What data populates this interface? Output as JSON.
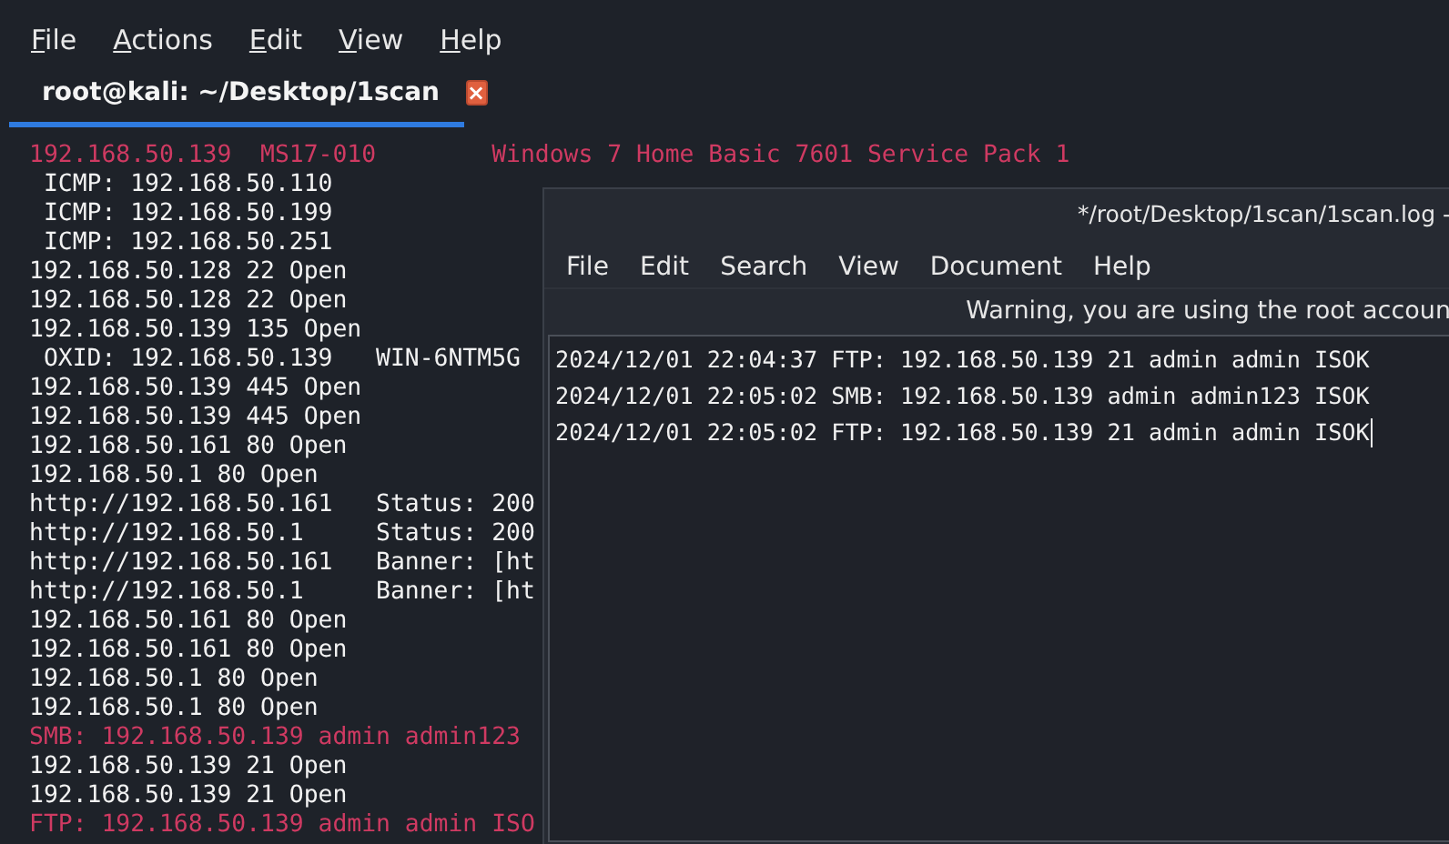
{
  "terminal": {
    "menu": [
      "File",
      "Actions",
      "Edit",
      "View",
      "Help"
    ],
    "tabs": [
      {
        "label": "root@kali: ~/Desktop/1scan",
        "selected": true,
        "close": "×"
      }
    ],
    "lines": [
      {
        "kind": "alert",
        "text": "192.168.50.139  MS17-010",
        "note": "Windows 7 Home Basic 7601 Service Pack 1"
      },
      {
        "kind": "plain",
        "text": " ICMP: 192.168.50.110"
      },
      {
        "kind": "plain",
        "text": " ICMP: 192.168.50.199"
      },
      {
        "kind": "plain",
        "text": " ICMP: 192.168.50.251"
      },
      {
        "kind": "plain",
        "text": "192.168.50.128 22 Open"
      },
      {
        "kind": "plain",
        "text": "192.168.50.128 22 Open"
      },
      {
        "kind": "plain",
        "text": "192.168.50.139 135 Open"
      },
      {
        "kind": "plain",
        "text": " OXID: 192.168.50.139",
        "note": "WIN-6NTM5G"
      },
      {
        "kind": "plain",
        "text": "192.168.50.139 445 Open"
      },
      {
        "kind": "plain",
        "text": "192.168.50.139 445 Open"
      },
      {
        "kind": "plain",
        "text": "192.168.50.161 80 Open"
      },
      {
        "kind": "plain",
        "text": "192.168.50.1 80 Open"
      },
      {
        "kind": "plain",
        "text": "http://192.168.50.161",
        "note": "Status: 200"
      },
      {
        "kind": "plain",
        "text": "http://192.168.50.1",
        "note": "Status: 200"
      },
      {
        "kind": "plain",
        "text": "http://192.168.50.161",
        "note": "Banner: [ht"
      },
      {
        "kind": "plain",
        "text": "http://192.168.50.1",
        "note": "Banner: [ht"
      },
      {
        "kind": "plain",
        "text": "192.168.50.161 80 Open"
      },
      {
        "kind": "plain",
        "text": "192.168.50.161 80 Open"
      },
      {
        "kind": "plain",
        "text": "192.168.50.1 80 Open"
      },
      {
        "kind": "plain",
        "text": "192.168.50.1 80 Open"
      },
      {
        "kind": "alert",
        "text": "SMB: 192.168.50.139 admin admin123"
      },
      {
        "kind": "plain",
        "text": "192.168.50.139 21 Open"
      },
      {
        "kind": "plain",
        "text": "192.168.50.139 21 Open"
      },
      {
        "kind": "alert",
        "text": "FTP: 192.168.50.139 admin admin ISO"
      }
    ]
  },
  "editor": {
    "title": "*/root/Desktop/1scan/1scan.log -",
    "menu": [
      "File",
      "Edit",
      "Search",
      "View",
      "Document",
      "Help"
    ],
    "warning": "Warning, you are using the root accoun",
    "lines": [
      {
        "text": "2024/12/01 22:04:37 FTP: 192.168.50.139 21 admin admin ISOK",
        "cursor": false
      },
      {
        "text": "2024/12/01 22:05:02 SMB: 192.168.50.139 admin admin123 ISOK",
        "cursor": false
      },
      {
        "text": "2024/12/01 22:05:02 FTP: 192.168.50.139 21 admin admin ISOK",
        "cursor": true
      }
    ]
  }
}
